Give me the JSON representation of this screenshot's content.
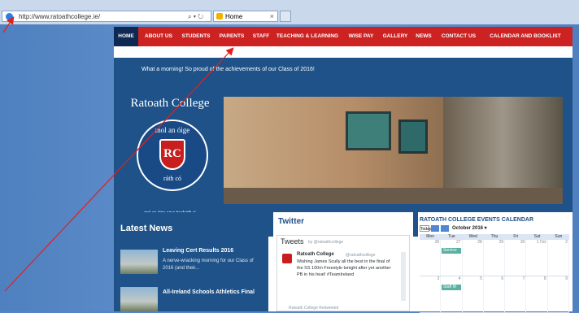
{
  "browser": {
    "url": "http://www.ratoathcollege.ie/",
    "address_tools": "⌕ ▾ ↻",
    "tab_title": "Home",
    "tab_close": "×"
  },
  "nav": {
    "items": [
      {
        "label": "HOME"
      },
      {
        "label": "ABOUT US"
      },
      {
        "label": "STUDENTS"
      },
      {
        "label": "PARENTS"
      },
      {
        "label": "STAFF"
      },
      {
        "label": "TEACHING & LEARNING"
      },
      {
        "label": "WISE PAY"
      },
      {
        "label": "GALLERY"
      },
      {
        "label": "NEWS"
      },
      {
        "label": "CONTACT US"
      },
      {
        "label": "CALENDAR AND BOOKLIST"
      }
    ]
  },
  "banner": {
    "text": "What a morning! So proud of the achievements of our Class of 2016!"
  },
  "hero": {
    "school_name": "Ratoath College",
    "crest_top": "mol an óige",
    "crest_letters": "RC",
    "crest_bottom": "ráth có",
    "motto": "mol an óige agus tiocfaidh sí"
  },
  "news": {
    "title": "Latest News",
    "items": [
      {
        "headline": "Leaving Cert Results 2016",
        "summary": "A nerve-wracking morning for our Class of 2016 (and their..."
      },
      {
        "headline": "All-Ireland Schools Athletics Final",
        "summary": ""
      }
    ]
  },
  "twitter": {
    "heading": "Twitter",
    "widget_title": "Tweets",
    "by": "by @ratoathcollege",
    "tweet": {
      "name": "Ratoath College",
      "handle": "@ratoathcollege",
      "text": "Wishing James Scully all the best in the final of the SS 100m Freestyle tonight after yet another PB in his heat! #TeamIreland"
    },
    "retweet_label": "Ratoath College Retweeted"
  },
  "calendar": {
    "title": "RATOATH COLLEGE EVENTS CALENDAR",
    "today_label": "Today",
    "month": "October 2016 ▾",
    "weekdays": [
      "Mon",
      "Tue",
      "Wed",
      "Thu",
      "Fri",
      "Sat",
      "Sun"
    ],
    "week1": [
      "26",
      "27",
      "28",
      "29",
      "30",
      "1 Oct",
      "2"
    ],
    "week2": [
      "3",
      "4",
      "5",
      "6",
      "7",
      "8",
      "9"
    ],
    "events": [
      "Service",
      "Staff M"
    ]
  },
  "colors": {
    "nav_red": "#cc2222",
    "navy": "#1e5288",
    "home_active": "#0e2a52",
    "event": "#5ab0a1",
    "annotation_arrow": "#e02020"
  }
}
